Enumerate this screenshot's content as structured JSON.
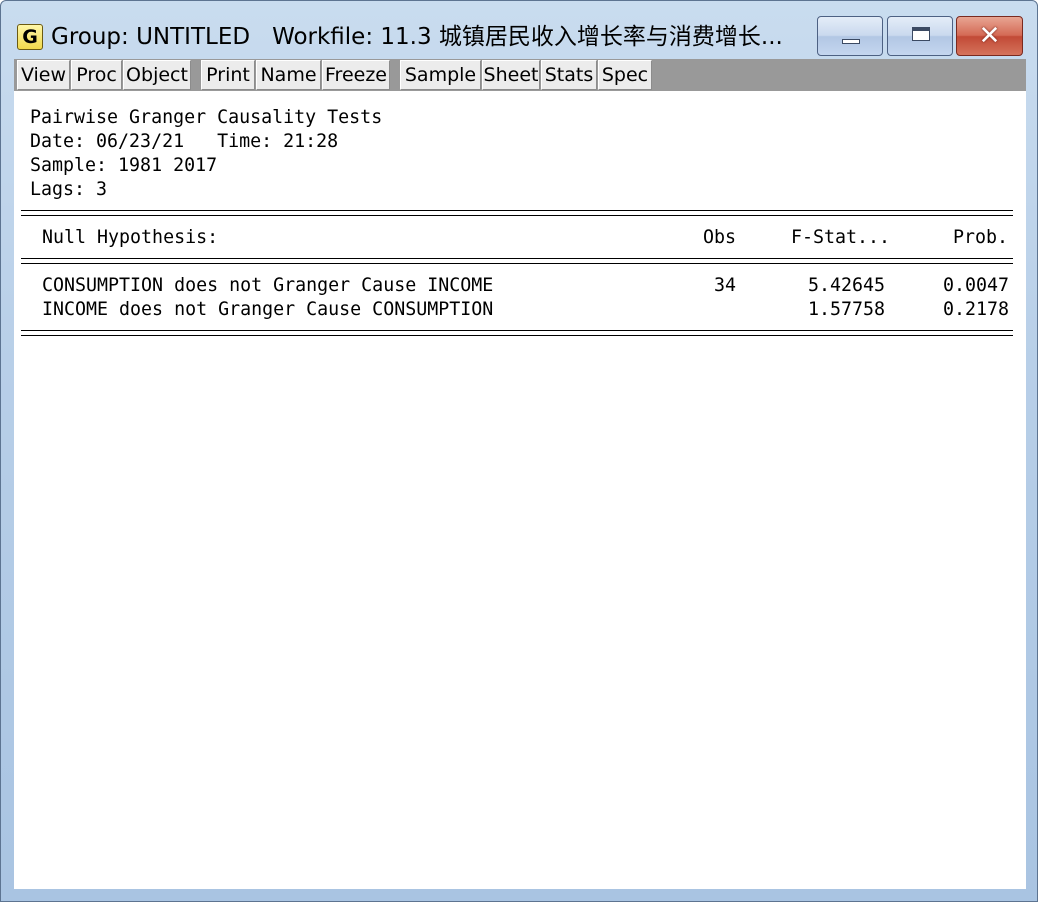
{
  "window": {
    "app_icon_letter": "G",
    "title_group": "Group: UNTITLED",
    "title_workfile": "Workfile: 11.3 城镇居民收入增长率与消费增长..."
  },
  "toolbar": {
    "buttons": [
      "View",
      "Proc",
      "Object",
      "Print",
      "Name",
      "Freeze",
      "Sample",
      "Sheet",
      "Stats",
      "Spec"
    ]
  },
  "output": {
    "heading": "Pairwise Granger Causality Tests",
    "date_line": "Date: 06/23/21   Time: 21:28",
    "sample_line": "Sample: 1981 2017",
    "lags_line": "Lags: 3",
    "columns": {
      "hypothesis": "Null Hypothesis:",
      "obs": "Obs",
      "fstat": "F-Stat...",
      "prob": "Prob."
    },
    "rows": [
      {
        "hypothesis": "CONSUMPTION does not Granger Cause INCOME",
        "obs": "34",
        "fstat": "5.42645",
        "prob": "0.0047"
      },
      {
        "hypothesis": "INCOME does not Granger Cause CONSUMPTION",
        "obs": "",
        "fstat": "1.57758",
        "prob": "0.2178"
      }
    ]
  }
}
